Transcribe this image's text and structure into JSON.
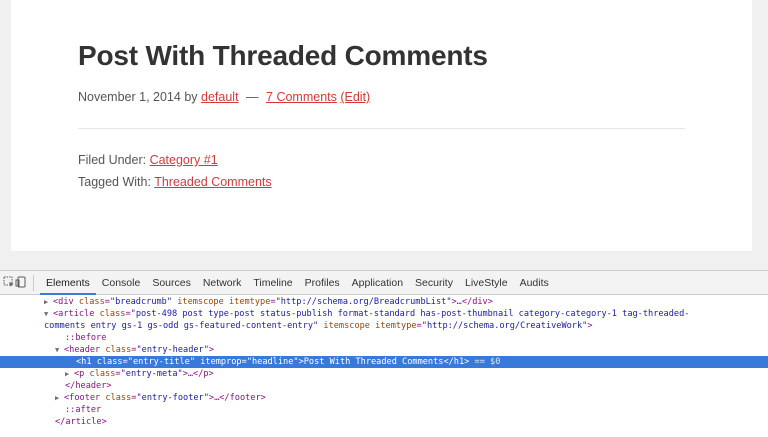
{
  "page": {
    "title": "Post With Threaded Comments",
    "meta": {
      "date": "November 1, 2014",
      "by": "by",
      "author": "default",
      "dash": "—",
      "comments": "7 Comments",
      "edit": "(Edit)"
    },
    "footer": {
      "filed_label": "Filed Under:",
      "filed_link": "Category #1",
      "tagged_label": "Tagged With:",
      "tagged_link": "Threaded Comments"
    }
  },
  "devtools": {
    "tabs": [
      "Elements",
      "Console",
      "Sources",
      "Network",
      "Timeline",
      "Profiles",
      "Application",
      "Security",
      "LiveStyle",
      "Audits"
    ],
    "active_tab": "Elements",
    "dom": {
      "l1": {
        "pre": "<div ",
        "a1": "class",
        "v1": "\"breadcrumb\"",
        "a2": "itemscope",
        "a3": "itemtype",
        "v3": "\"http://schema.org/BreadcrumbList\"",
        "post": ">…</div>"
      },
      "l2": {
        "pre": "<article ",
        "a1": "class",
        "v1": "\"post-498 post type-post status-publish format-standard has-post-thumbnail category-category-1 tag-threaded-"
      },
      "l3": {
        "v1": "comments entry gs-1 gs-odd gs-featured-content-entry\"",
        "a2": "itemscope",
        "a3": "itemtype",
        "v3": "\"http://schema.org/CreativeWork\"",
        "post": ">"
      },
      "l4": "::before",
      "l5": {
        "pre": "<header ",
        "a1": "class",
        "v1": "\"entry-header\"",
        "post": ">"
      },
      "l6": {
        "pre": "<h1 ",
        "a1": "class",
        "v1": "\"entry-title\"",
        "a2": "itemprop",
        "v2": "\"headline\"",
        "text": "Post With Threaded Comments",
        "close": "</h1>",
        "eq": "== $0"
      },
      "l7": {
        "pre": "<p ",
        "a1": "class",
        "v1": "\"entry-meta\"",
        "post": ">…</p>"
      },
      "l8": "</header>",
      "l9": {
        "pre": "<footer ",
        "a1": "class",
        "v1": "\"entry-footer\"",
        "post": ">…</footer>"
      },
      "l10": "::after",
      "l11": "</article>"
    }
  },
  "colors": {
    "link": "#d43a3a",
    "selection": "#3879d9",
    "tag": "#881280",
    "attr_name": "#994500",
    "attr_value": "#1a1aa6"
  }
}
